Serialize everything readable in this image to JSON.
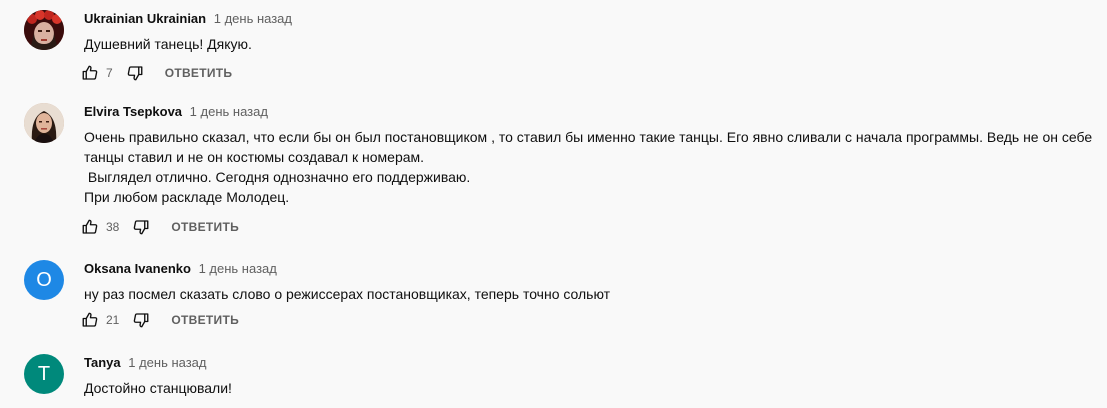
{
  "comments": [
    {
      "author": "Ukrainian Ukrainian",
      "time": "1 день назад",
      "text": "Душевний танець! Дякую.",
      "likes": "7",
      "reply_label": "ОТВЕТИТЬ",
      "avatar": {
        "type": "photo",
        "description_icon": "user-photo-icon",
        "color": "#5a1212"
      }
    },
    {
      "author": "Elvira Tsepkova",
      "time": "1 день назад",
      "text": "Очень правильно сказал, что если бы он был постановщиком , то ставил бы именно такие танцы. Его явно сливали с начала программы. Ведь не он себе танцы ставил и не он костюмы создавал к номерам.\n Выглядел отлично. Сегодня однозначно его поддерживаю.\nПри любом раскладе Молодец.",
      "likes": "38",
      "reply_label": "ОТВЕТИТЬ",
      "avatar": {
        "type": "photo",
        "description_icon": "user-photo-icon",
        "color": "#c9a48a"
      }
    },
    {
      "author": "Oksana Ivanenko",
      "time": "1 день назад",
      "text": "ну раз посмел сказать слово о режиссерах постановщиках, теперь точно сольют",
      "likes": "21",
      "reply_label": "ОТВЕТИТЬ",
      "avatar": {
        "type": "letter",
        "letter": "O",
        "color": "#1e88e5"
      }
    },
    {
      "author": "Tanya",
      "time": "1 день назад",
      "text": "Достойно станцювали!",
      "avatar": {
        "type": "letter",
        "letter": "T",
        "color": "#00897b"
      }
    }
  ],
  "icons": {
    "like": "thumb-up-icon",
    "dislike": "thumb-down-icon"
  },
  "colors": {
    "background": "#f9f9f9",
    "secondary_text": "#606060",
    "primary_text": "#0f0f0f"
  }
}
